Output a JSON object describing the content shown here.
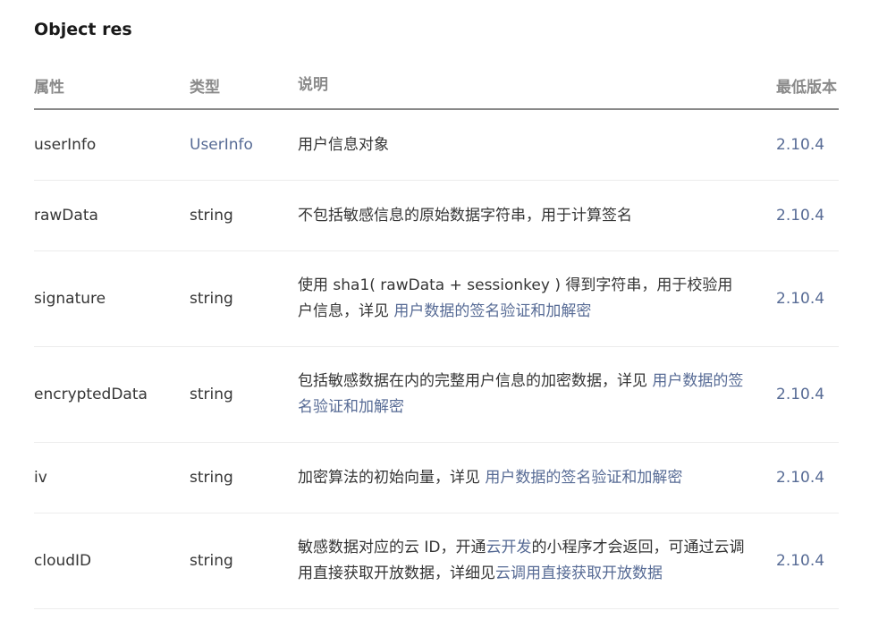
{
  "title": "Object res",
  "colors": {
    "link": "#576b95",
    "text": "#353535",
    "header": "#8a8a8a"
  },
  "headers": {
    "attr": "属性",
    "type": "类型",
    "desc": "说明",
    "version": "最低版本"
  },
  "rows": [
    {
      "name": "userInfo",
      "type": "UserInfo",
      "desc_parts": [
        "用户信息对象"
      ],
      "version": "2.10.4"
    },
    {
      "name": "rawData",
      "type": "string",
      "desc_parts": [
        "不包括敏感信息的原始数据字符串，用于计算签名"
      ],
      "version": "2.10.4"
    },
    {
      "name": "signature",
      "type": "string",
      "desc_parts": [
        "使用 sha1( rawData + sessionkey ) 得到字符串，用于校验用户信息，详见 ",
        "用户数据的签名验证和加解密"
      ],
      "version": "2.10.4"
    },
    {
      "name": "encryptedData",
      "type": "string",
      "desc_parts": [
        "包括敏感数据在内的完整用户信息的加密数据，详见 ",
        "用户数据的签名验证和加解密"
      ],
      "version": "2.10.4"
    },
    {
      "name": "iv",
      "type": "string",
      "desc_parts": [
        "加密算法的初始向量，详见 ",
        "用户数据的签名验证和加解密"
      ],
      "version": "2.10.4"
    },
    {
      "name": "cloudID",
      "type": "string",
      "desc_parts": [
        "敏感数据对应的云 ID，开通",
        "云开发",
        "的小程序才会返回，可通过云调用直接获取开放数据，详细见",
        "云调用直接获取开放数据"
      ],
      "version": "2.10.4"
    }
  ]
}
